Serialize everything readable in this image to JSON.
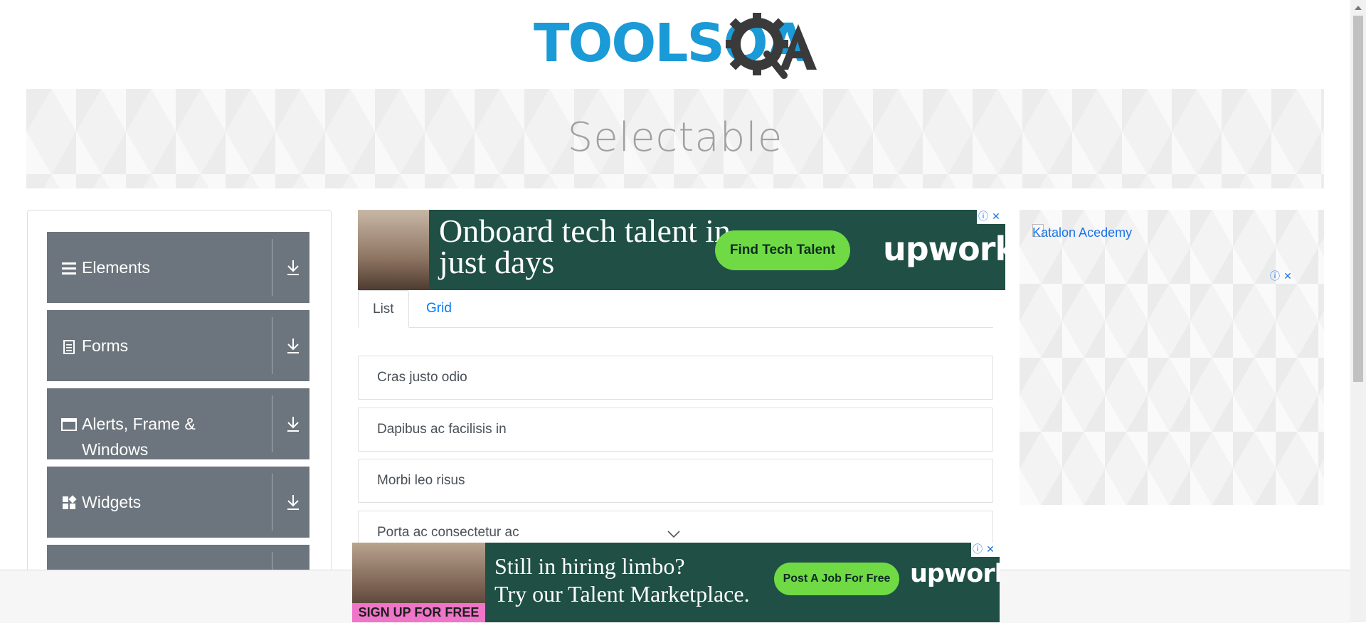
{
  "logo": {
    "text": "TOOLSQA"
  },
  "banner": {
    "title": "Selectable"
  },
  "sidebar": {
    "groups": [
      {
        "label": "Elements",
        "icon": "hamburger-icon"
      },
      {
        "label": "Forms",
        "icon": "document-icon"
      },
      {
        "label": "Alerts, Frame & Windows",
        "icon": "window-icon"
      },
      {
        "label": "Widgets",
        "icon": "widgets-icon"
      }
    ]
  },
  "ad_top": {
    "headline": "Onboard tech talent in just days",
    "cta": "Find Tech Talent",
    "brand": "upwork"
  },
  "tabs": [
    {
      "label": "List",
      "active": true
    },
    {
      "label": "Grid",
      "active": false
    }
  ],
  "list_items": [
    "Cras justo odio",
    "Dapibus ac facilisis in",
    "Morbi leo risus",
    "Porta ac consectetur ac"
  ],
  "ad_right": {
    "alt_text": "Katalon Acedemy"
  },
  "ad_bottom": {
    "headline_line1": "Still in hiring limbo?",
    "headline_line2": "Try our Talent Marketplace.",
    "cta": "Post A Job For Free",
    "brand": "upwork",
    "signup": "SIGN UP FOR FREE"
  },
  "colors": {
    "accent": "#1a9ad6",
    "sidebar_bg": "#6c757d",
    "ad_bg": "#1f4f45",
    "ad_cta": "#6fda44",
    "link": "#007bff"
  }
}
